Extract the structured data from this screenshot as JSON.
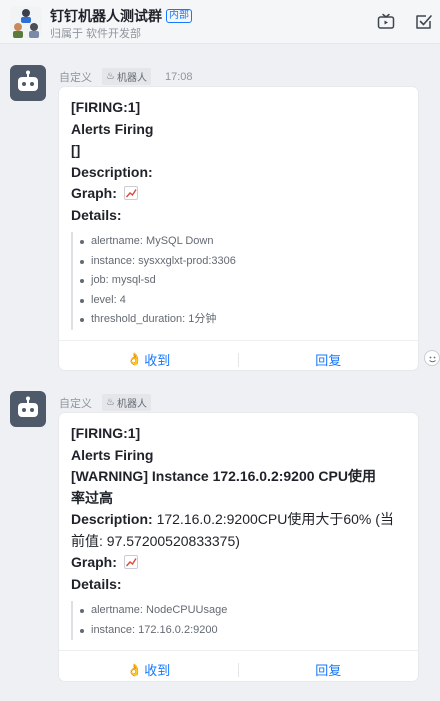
{
  "header": {
    "title": "钉钉机器人测试群",
    "badge": "内部",
    "subtitle": "归属于 软件开发部"
  },
  "messages": [
    {
      "sender": "自定义",
      "tag": "机器人",
      "time": "17:08",
      "firing": "[FIRING:1]",
      "alerts": "Alerts Firing",
      "headline": "[]",
      "description_label": "Description:",
      "description_value": "",
      "graph_label": "Graph:",
      "details_label": "Details:",
      "details": [
        "alertname: MySQL Down",
        "instance: sysxxglxt-prod:3306",
        "job: mysql-sd",
        "level: 4",
        "threshold_duration: 1分钟"
      ],
      "action_collapse": "收到",
      "action_reply": "回复"
    },
    {
      "sender": "自定义",
      "tag": "机器人",
      "time": "",
      "firing": "[FIRING:1]",
      "alerts": "Alerts Firing",
      "headline_1": "[WARNING] Instance 172.16.0.2:9200 CPU使用",
      "headline_2": "率过高",
      "description_label": "Description:",
      "description_value_1": " 172.16.0.2:9200CPU使用大于60% (当",
      "description_value_2": "前值: 97.57200520833375)",
      "graph_label": "Graph:",
      "details_label": "Details:",
      "details": [
        "alertname: NodeCPUUsage",
        "instance: 172.16.0.2:9200"
      ],
      "action_collapse": "收到",
      "action_reply": "回复"
    }
  ]
}
